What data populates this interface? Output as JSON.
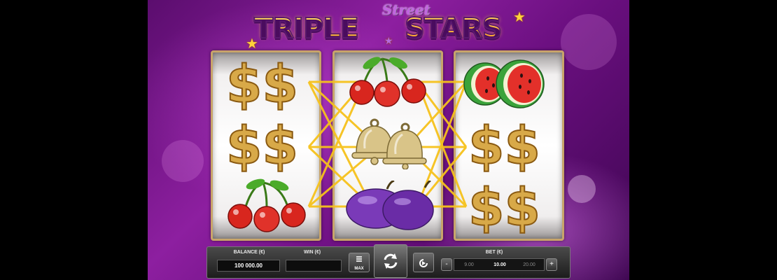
{
  "game": {
    "logo_word_1": "Street",
    "logo_word_2": "TRIPLE",
    "logo_word_3": "STARS"
  },
  "reels": [
    {
      "symbols": [
        "dollar-signs",
        "dollar-signs",
        "cherries"
      ]
    },
    {
      "symbols": [
        "cherries",
        "bells",
        "plums"
      ]
    },
    {
      "symbols": [
        "watermelons",
        "dollar-signs",
        "dollar-signs"
      ]
    }
  ],
  "colors": {
    "background": "#8d1fa0",
    "payline": "#f6c21c",
    "reel_frame": "#c8a46a"
  },
  "controls": {
    "balance_label": "BALANCE (€)",
    "balance_value": "100 000.00",
    "win_label": "WIN (€)",
    "win_value": "",
    "max_label": "MAX",
    "bet_label": "BET (€)",
    "bet_minus": "-",
    "bet_plus": "+",
    "bet_prev": "9.00",
    "bet_current": "10.00",
    "bet_next": "20.00"
  }
}
